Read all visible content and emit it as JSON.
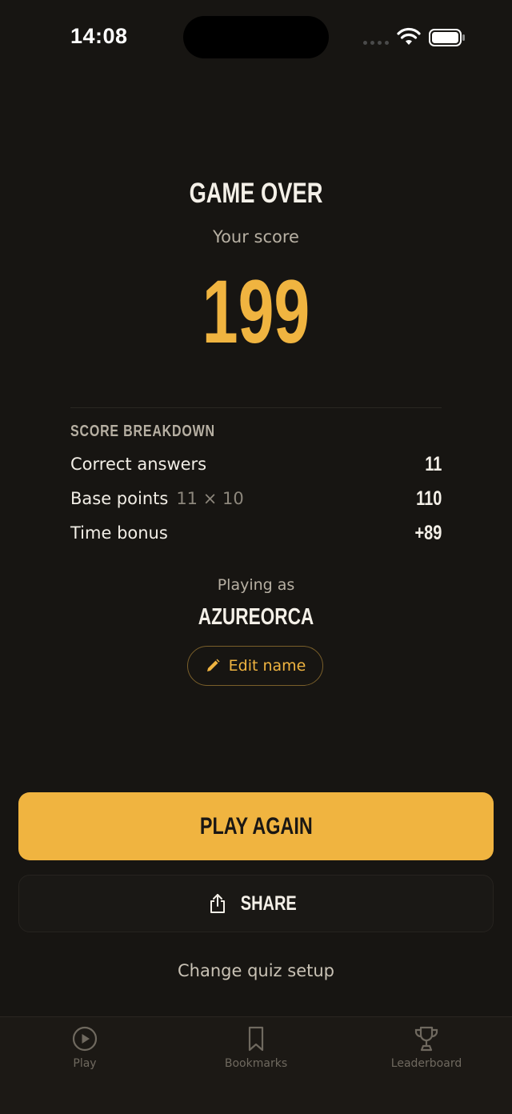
{
  "status_bar": {
    "time": "14:08"
  },
  "header": {
    "title": "GAME OVER",
    "subtitle": "Your score",
    "score": "199"
  },
  "breakdown": {
    "heading": "SCORE BREAKDOWN",
    "rows": [
      {
        "label": "Correct answers",
        "detail": "",
        "value": "11"
      },
      {
        "label": "Base points",
        "detail": "11 × 10",
        "value": "110"
      },
      {
        "label": "Time bonus",
        "detail": "",
        "value": "+89"
      }
    ]
  },
  "player": {
    "playing_as_label": "Playing as",
    "name": "AZUREORCA",
    "edit_label": "Edit name"
  },
  "actions": {
    "play_again": "PLAY AGAIN",
    "share": "SHARE",
    "change_setup": "Change quiz setup"
  },
  "tabs": [
    {
      "label": "Play",
      "icon": "play-circle-icon"
    },
    {
      "label": "Bookmarks",
      "icon": "bookmark-icon"
    },
    {
      "label": "Leaderboard",
      "icon": "trophy-icon"
    }
  ],
  "colors": {
    "background": "#171512",
    "accent": "#f0b440",
    "tab_bar": "#1c1915"
  }
}
